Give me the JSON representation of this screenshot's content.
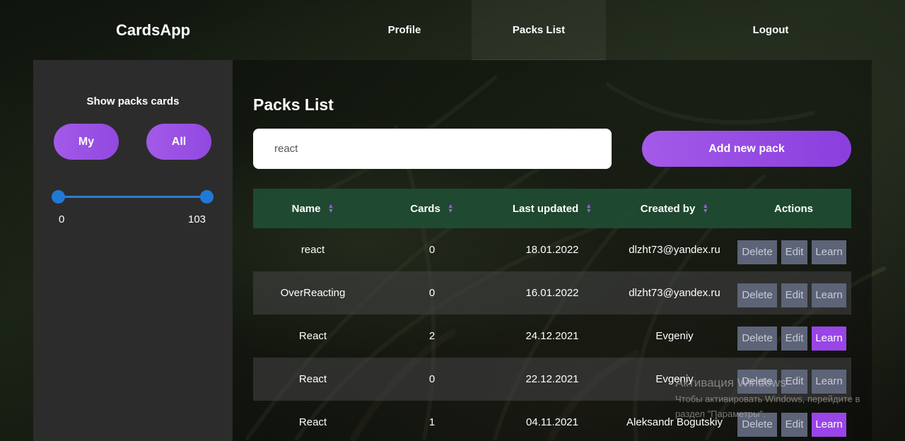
{
  "header": {
    "logo": "CardsApp",
    "nav": {
      "profile": "Profile",
      "packs_list": "Packs List",
      "logout": "Logout"
    }
  },
  "sidebar": {
    "title": "Show packs cards",
    "buttons": {
      "my": "My",
      "all": "All"
    },
    "range": {
      "min": "0",
      "max": "103"
    }
  },
  "main": {
    "title": "Packs List",
    "search": {
      "value": "react",
      "placeholder": ""
    },
    "add_button": "Add new pack",
    "accent_color": "#9a45e8",
    "table": {
      "headers": {
        "name": "Name",
        "cards": "Cards",
        "last_updated": "Last updated",
        "created_by": "Created by",
        "actions": "Actions"
      },
      "actions": {
        "delete": "Delete",
        "edit": "Edit",
        "learn": "Learn"
      },
      "rows": [
        {
          "name": "react",
          "cards": "0",
          "updated": "18.01.2022",
          "created_by": "dlzht73@yandex.ru",
          "learn_active": false
        },
        {
          "name": "OverReacting",
          "cards": "0",
          "updated": "16.01.2022",
          "created_by": "dlzht73@yandex.ru",
          "learn_active": false
        },
        {
          "name": "React",
          "cards": "2",
          "updated": "24.12.2021",
          "created_by": "Evgeniy",
          "learn_active": true
        },
        {
          "name": "React",
          "cards": "0",
          "updated": "22.12.2021",
          "created_by": "Evgeniy",
          "learn_active": false
        },
        {
          "name": "React",
          "cards": "1",
          "updated": "04.11.2021",
          "created_by": "Aleksandr Bogutskiy",
          "learn_active": true
        }
      ]
    }
  },
  "watermark": {
    "title": "Активация Windows",
    "line1": "Чтобы активировать Windows, перейдите в",
    "line2": "раздел \"Параметры\"."
  }
}
